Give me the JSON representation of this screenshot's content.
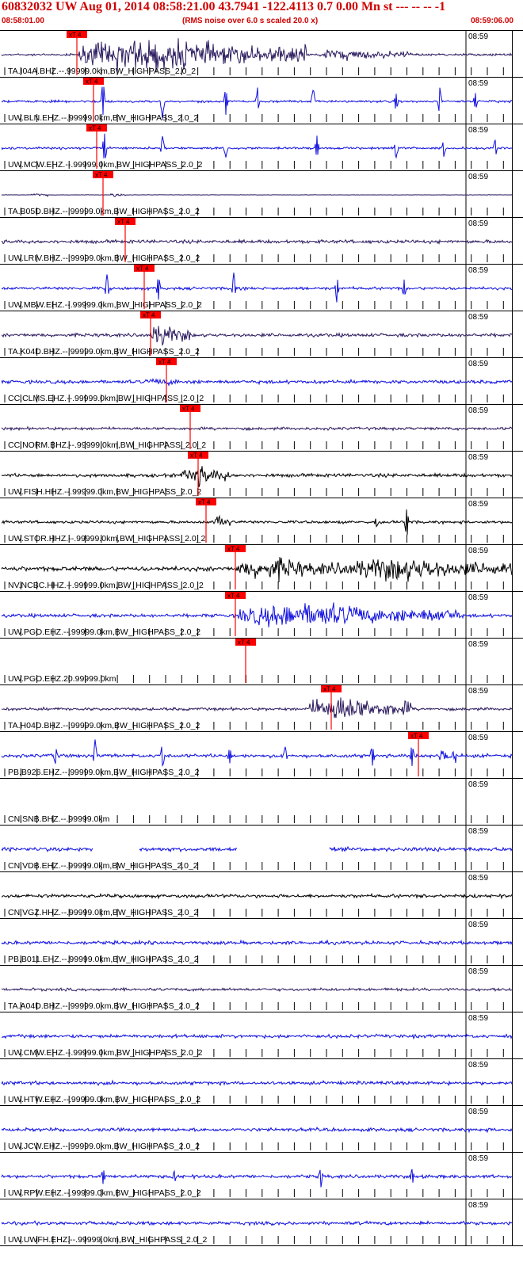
{
  "header": {
    "title": "60832032 UW Aug 01, 2014 08:58:21.00   43.7941 -122.4113  0.7 0.00 Mn st --- -- --  -1",
    "start_time": "08:58:01.00",
    "rms_note": "(RMS noise over 6.0 s scaled 20.0 x)",
    "end_time": "08:59:06.00"
  },
  "chart_data": {
    "type": "line",
    "title": "60832032 UW Aug 01, 2014 08:58:21.00   43.7941 -122.4113  0.7 0.00 Mn st --- -- --  -1",
    "x_range": [
      "08:58:01.00",
      "08:59:06.00"
    ],
    "time_label": "08:59",
    "pick_label": "xT 4",
    "colors": {
      "black": "#000000",
      "purple": "#2b1a5e",
      "blue": "#1010e0",
      "pick": "#ff0000",
      "frame": "#000000"
    },
    "series": [
      {
        "name": "TA.I04A.BHZ.--.99999.0km,BW_HIGHPASS_2.0_2",
        "color": "purple",
        "pick": true
      },
      {
        "name": "UW.BLN.EHZ.--.99999.0km,BW_HIGHPASS_2.0_2",
        "color": "blue",
        "pick": true
      },
      {
        "name": "UW.MCW.EHZ.--.99999.0km,BW_HIGHPASS_2.0_2",
        "color": "blue",
        "pick": true
      },
      {
        "name": "TA.B05D.BHZ.--.99999.0km,BW_HIGHPASS_2.0_2",
        "color": "purple",
        "pick": true
      },
      {
        "name": "UW.LRIV.BHZ.--.99999.0km,BW_HIGHPASS_2.0_2",
        "color": "purple",
        "pick": true
      },
      {
        "name": "UW.MBW.EHZ.--.99999.0km,BW_HIGHPASS_2.0_2",
        "color": "blue",
        "pick": true
      },
      {
        "name": "TA.K04D.BHZ.--.99999.0km,BW_HIGHPASS_2.0_2",
        "color": "purple",
        "pick": true
      },
      {
        "name": "CC.CLMS.EHZ.--.99999.0km,BW_HIGHPASS_2.0_2",
        "color": "blue",
        "pick": true
      },
      {
        "name": "CC.NORM.BHZ.--.99999.0km,BW_HIGHPASS_2.0_2",
        "color": "purple",
        "pick": true
      },
      {
        "name": "UW.FISH.HHZ.--.99999.0km,BW_HIGHPASS_2.0_2",
        "color": "black",
        "pick": true
      },
      {
        "name": "UW.STOR.HHZ.--.99999.0km,BW_HIGHPASS_2.0_2",
        "color": "black",
        "pick": true
      },
      {
        "name": "NV.NCBC.HHZ.--.99999.0km,BW_HIGHPASS_2.0_2",
        "color": "black",
        "pick": true
      },
      {
        "name": "UW.PGO.EHZ.--.99999.0km,BW_HIGHPASS_2.0_2",
        "color": "blue",
        "pick": true
      },
      {
        "name": "UW.PGO.EHZ.20.99999.0km",
        "color": "blue",
        "pick": true
      },
      {
        "name": "TA.H04D.BHZ.--.99999.0km,BW_HIGHPASS_2.0_2",
        "color": "purple",
        "pick": true
      },
      {
        "name": "PB.B926.EHZ.--.99999.0km,BW_HIGHPASS_2.0_2",
        "color": "blue",
        "pick": true
      },
      {
        "name": "CN.SNB.BHZ.--.99999.0km",
        "color": "black",
        "pick": false
      },
      {
        "name": "CN.VDB.EHZ.--.99999.0km,BW_HIGHPASS_2.0_2",
        "color": "blue",
        "pick": false
      },
      {
        "name": "CN.VGZ.HHZ.--.99999.0km,BW_HIGHPASS_2.0_2",
        "color": "black",
        "pick": false
      },
      {
        "name": "PB.B011.EHZ.--.99999.0km,BW_HIGHPASS_2.0_2",
        "color": "blue",
        "pick": false
      },
      {
        "name": "TA.A04D.BHZ.--.99999.0km,BW_HIGHPASS_2.0_2",
        "color": "purple",
        "pick": false
      },
      {
        "name": "UW.CMW.EHZ.--.99999.0km,BW_HIGHPASS_2.0_2",
        "color": "blue",
        "pick": false
      },
      {
        "name": "UW.HTW.EHZ.--.99999.0km,BW_HIGHPASS_2.0_2",
        "color": "blue",
        "pick": false
      },
      {
        "name": "UW.JCW.EHZ.--.99999.0km,BW_HIGHPASS_2.0_2",
        "color": "blue",
        "pick": false
      },
      {
        "name": "UW.RPW.EHZ.--.99999.0km,BW_HIGHPASS_2.0_2",
        "color": "blue",
        "pick": false
      },
      {
        "name": "UW.UWFH.EHZ.--.99999.0km,BW_HIGHPASS_2.0_2",
        "color": "blue",
        "pick": false
      }
    ]
  }
}
